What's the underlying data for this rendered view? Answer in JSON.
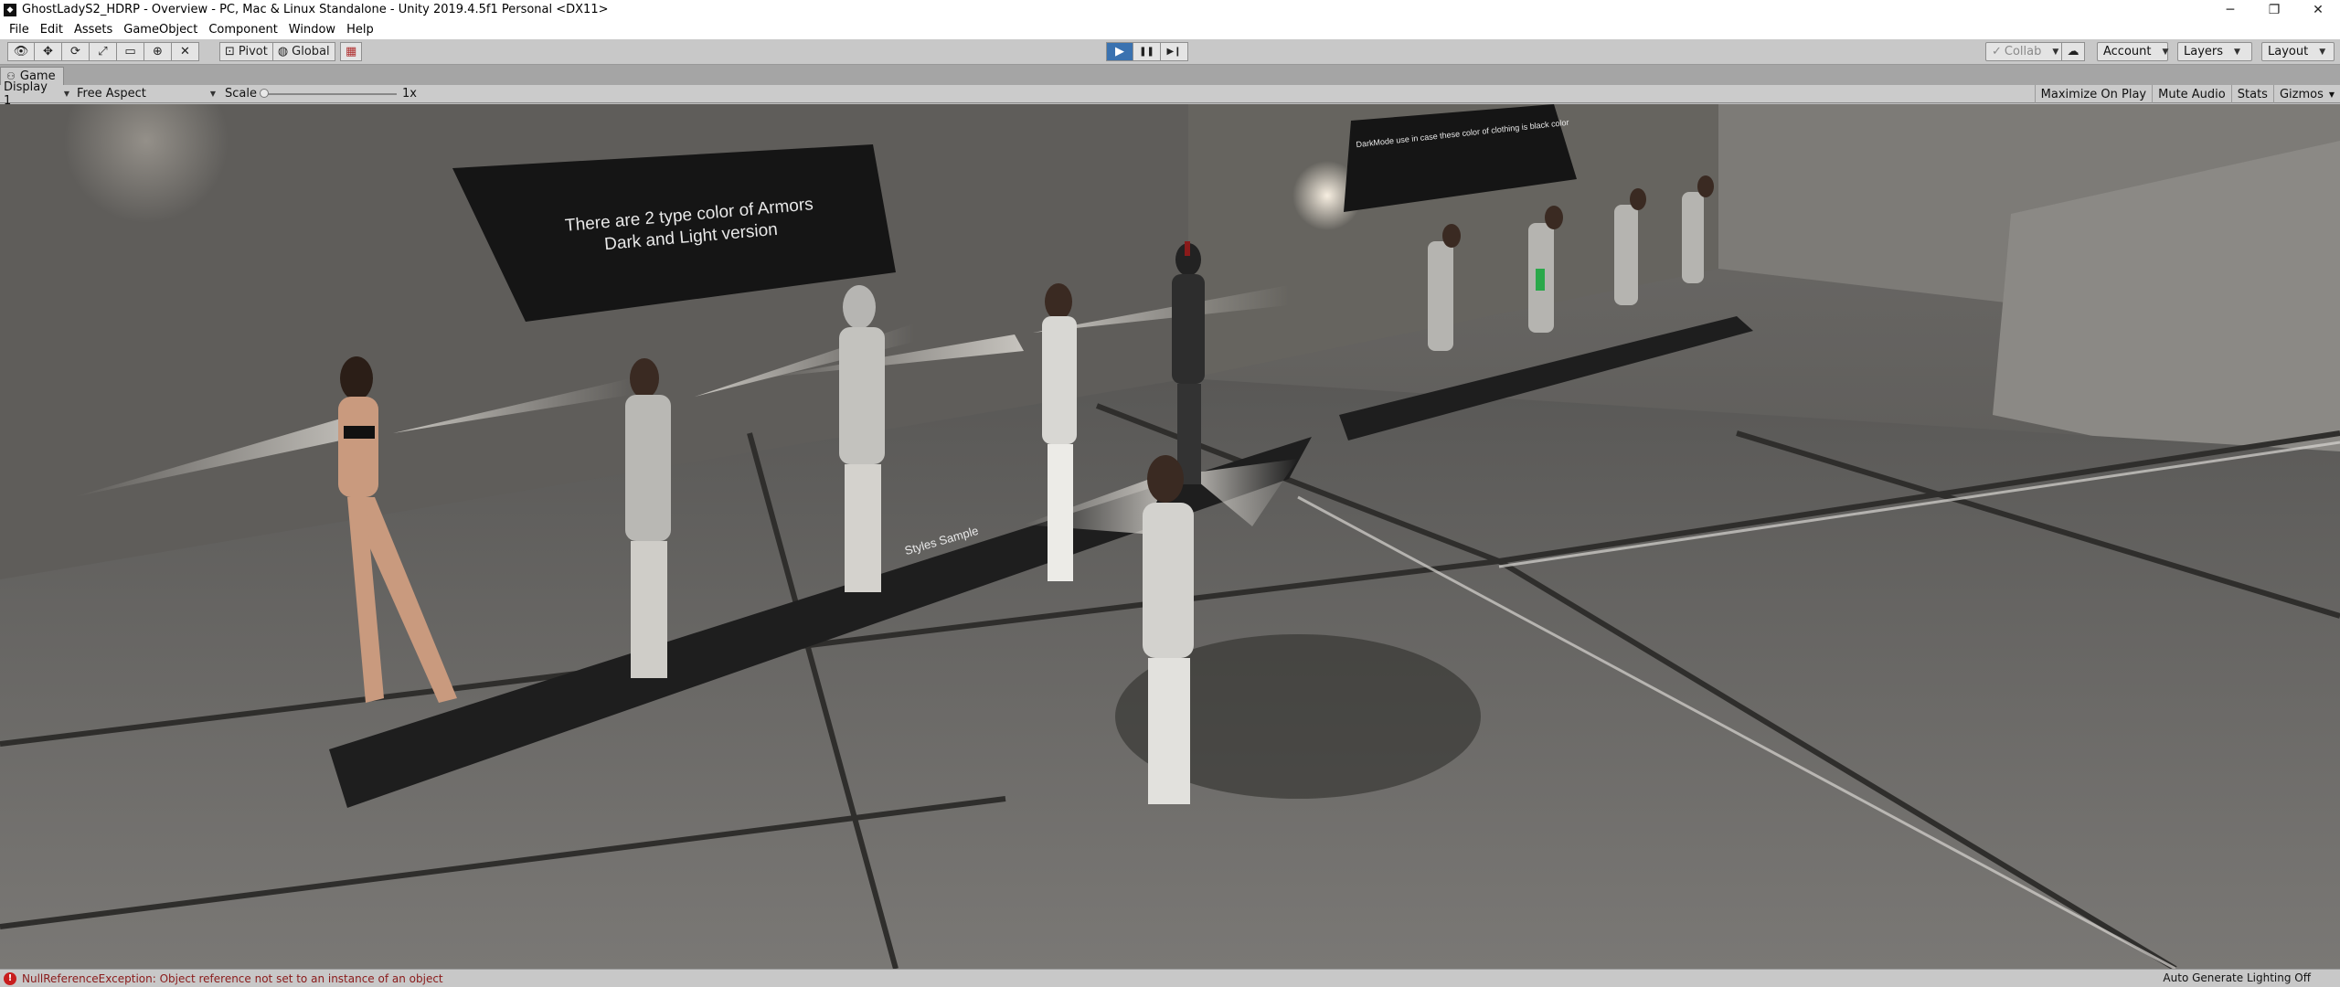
{
  "window": {
    "title": "GhostLadyS2_HDRP - Overview - PC, Mac & Linux Standalone - Unity 2019.4.5f1 Personal <DX11>",
    "controls": {
      "minimize": "─",
      "maximize": "❐",
      "close": "✕"
    }
  },
  "menu": [
    "File",
    "Edit",
    "Assets",
    "GameObject",
    "Component",
    "Window",
    "Help"
  ],
  "toolbar": {
    "pivot_label": "Pivot",
    "global_label": "Global",
    "play_icon": "▶",
    "pause_icon": "❚❚",
    "step_icon": "▶❙",
    "collab_label": "Collab",
    "account_label": "Account",
    "layers_label": "Layers",
    "layout_label": "Layout"
  },
  "game_tab": {
    "label": "Game"
  },
  "game_toolbar": {
    "display": "Display 1",
    "aspect": "Free Aspect",
    "scale_label": "Scale",
    "scale_value": "1x",
    "maximize_on_play": "Maximize On Play",
    "mute_audio": "Mute Audio",
    "stats": "Stats",
    "gizmos": "Gizmos"
  },
  "scene": {
    "sign_left_line1": "There are 2 type color of Armors",
    "sign_left_line2": "Dark and Light version",
    "sign_right": "DarkMode use in case these color of clothing is black color",
    "floor_label": "Styles Sample"
  },
  "status": {
    "error": "NullReferenceException: Object reference not set to an instance of an object",
    "lighting": "Auto Generate Lighting Off"
  },
  "colors": {
    "play_active": "#3a72b0",
    "error_red": "#c81e1e"
  }
}
